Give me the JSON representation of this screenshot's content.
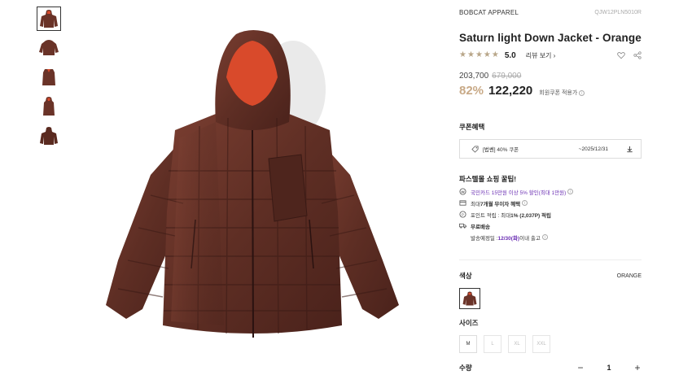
{
  "product": {
    "brand": "BOBCAT APPAREL",
    "code": "QJW12PLN5010R",
    "title": "Saturn light Down Jacket - Orange",
    "rating": "5.0",
    "review_link": "리뷰 보기 ›",
    "stars": 5
  },
  "price": {
    "sale": "203,700",
    "original": "679,000",
    "discount": "82%",
    "final": "122,220",
    "coupon_note": "회원쿠폰 적용가"
  },
  "coupon": {
    "title": "쿠폰혜택",
    "name": "[법쎈] 40% 쿠폰",
    "date": "~2025/12/31"
  },
  "tips": {
    "title": "파스텔몰 쇼핑 꿀팁!",
    "card": "국민카드 15만원 이상 5% 할인(최대 1만원)",
    "installment_pre": "최대 ",
    "installment_bold": "7개월 무이자 혜택",
    "points_pre": "포인트 적립 : 최대 ",
    "points_bold": "1% (2,037P) 적립",
    "shipping": "무료배송",
    "ship_date_pre": "발송예정일 : ",
    "ship_date": "12/30(화)",
    "ship_date_post": " 이내 출고"
  },
  "color": {
    "title": "색상",
    "selected": "ORANGE"
  },
  "size": {
    "title": "사이즈",
    "options": [
      "M",
      "L",
      "XL",
      "XXL"
    ]
  },
  "quantity": {
    "title": "수량",
    "value": "1",
    "minus": "−",
    "plus": "+"
  },
  "icons": {
    "heart": "heart-icon",
    "share": "share-icon",
    "tag": "tag-icon",
    "download": "download-icon",
    "card": "card-icon",
    "points": "points-icon",
    "truck": "truck-icon"
  },
  "colors": {
    "star": "#b8a689",
    "discount": "#c8a986",
    "highlight": "#6b2fb3",
    "jacket": "#5e2e24",
    "lining": "#d94a2b"
  }
}
